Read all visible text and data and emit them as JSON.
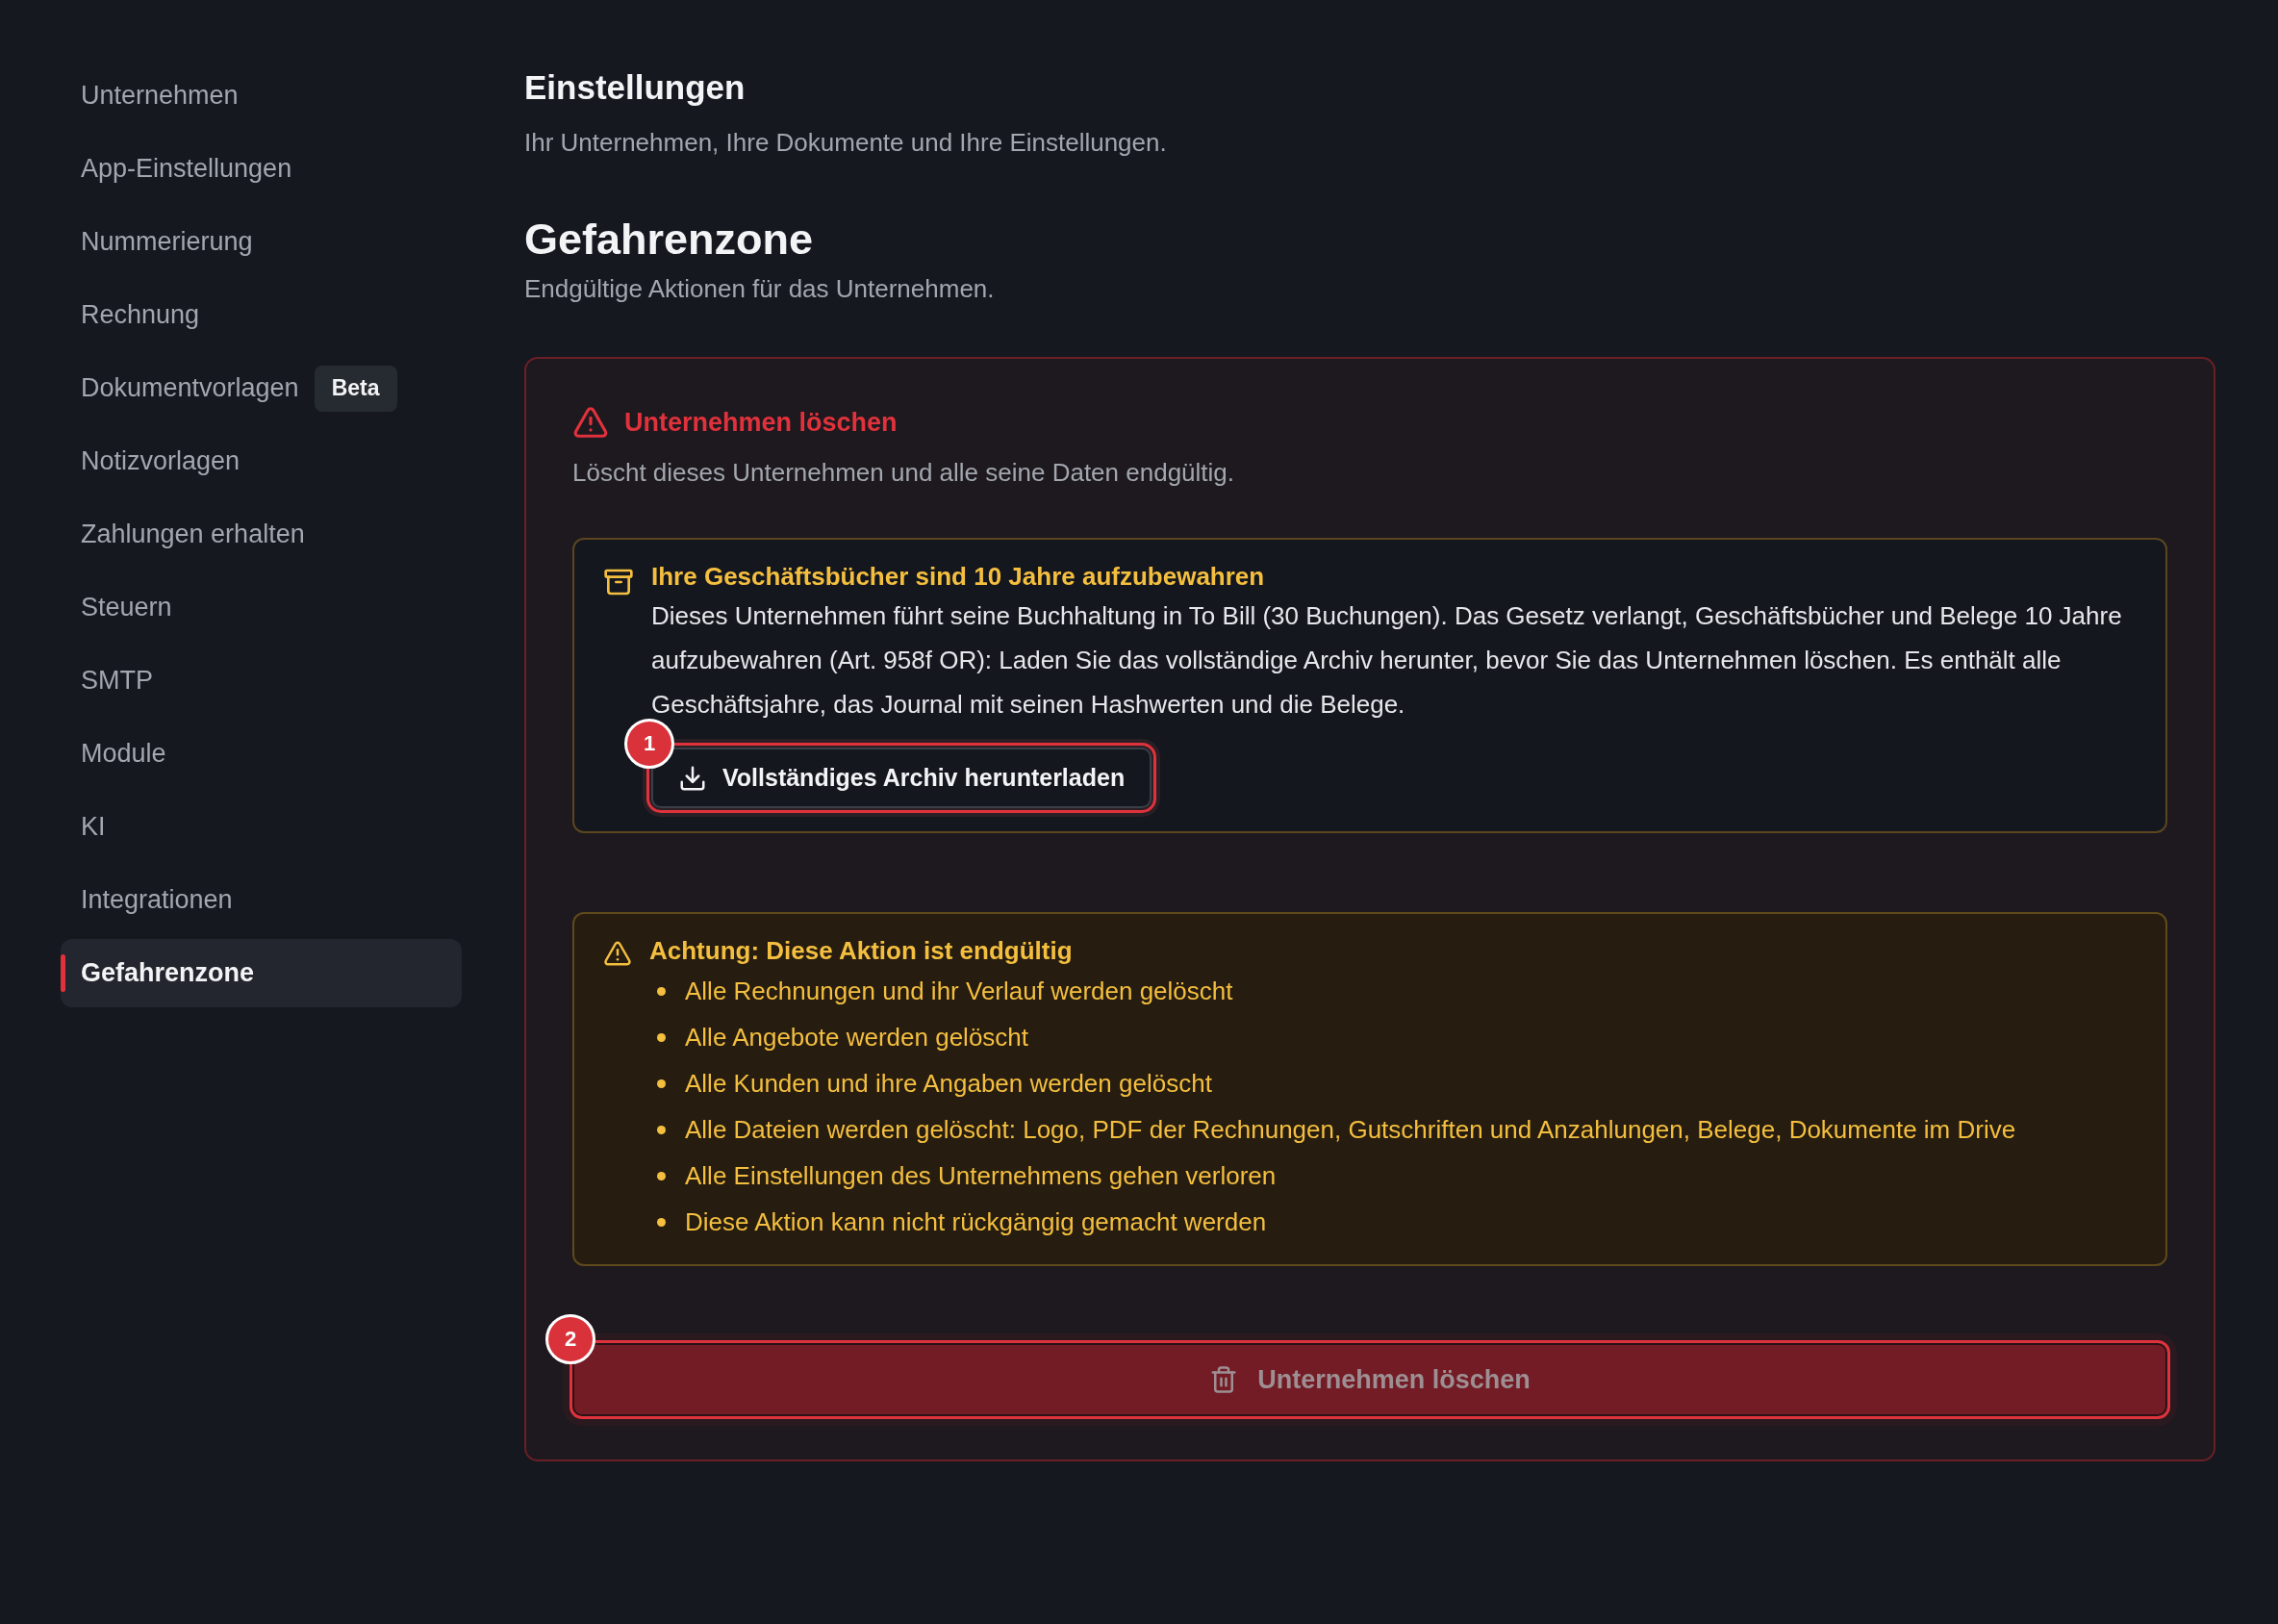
{
  "sidebar": {
    "items": [
      {
        "label": "Unternehmen",
        "selected": false
      },
      {
        "label": "App-Einstellungen",
        "selected": false
      },
      {
        "label": "Nummerierung",
        "selected": false
      },
      {
        "label": "Rechnung",
        "selected": false
      },
      {
        "label": "Dokumentvorlagen",
        "selected": false,
        "badge": "Beta"
      },
      {
        "label": "Notizvorlagen",
        "selected": false
      },
      {
        "label": "Zahlungen erhalten",
        "selected": false
      },
      {
        "label": "Steuern",
        "selected": false
      },
      {
        "label": "SMTP",
        "selected": false
      },
      {
        "label": "Module",
        "selected": false
      },
      {
        "label": "KI",
        "selected": false
      },
      {
        "label": "Integrationen",
        "selected": false
      },
      {
        "label": "Gefahrenzone",
        "selected": true
      }
    ]
  },
  "header": {
    "title": "Einstellungen",
    "subtitle": "Ihr Unternehmen, Ihre Dokumente und Ihre Einstellungen."
  },
  "section": {
    "title": "Gefahrenzone",
    "subtitle": "Endgültige Aktionen für das Unternehmen."
  },
  "danger_card": {
    "title": "Unternehmen löschen",
    "description": "Löscht dieses Unternehmen und alle seine Daten endgültig.",
    "archive_notice": {
      "title": "Ihre Geschäftsbücher sind 10 Jahre aufzubewahren",
      "body": "Dieses Unternehmen führt seine Buchhaltung in To Bill (30 Buchungen). Das Gesetz verlangt, Geschäftsbücher und Belege 10 Jahre aufzubewahren (Art. 958f OR): Laden Sie das vollständige Archiv herunter, bevor Sie das Unternehmen löschen. Es enthält alle Geschäftsjahre, das Journal mit seinen Hashwerten und die Belege.",
      "button": {
        "label": "Vollständiges Archiv herunterladen",
        "callout": "1"
      }
    },
    "warning": {
      "title": "Achtung: Diese Aktion ist endgültig",
      "items": [
        "Alle Rechnungen und ihr Verlauf werden gelöscht",
        "Alle Angebote werden gelöscht",
        "Alle Kunden und ihre Angaben werden gelöscht",
        "Alle Dateien werden gelöscht: Logo, PDF der Rechnungen, Gutschriften und Anzahlungen, Belege, Dokumente im Drive",
        "Alle Einstellungen des Unternehmens gehen verloren",
        "Diese Aktion kann nicht rückgängig gemacht werden"
      ]
    },
    "delete_button": {
      "label": "Unternehmen löschen",
      "disabled": true,
      "callout": "2"
    }
  }
}
